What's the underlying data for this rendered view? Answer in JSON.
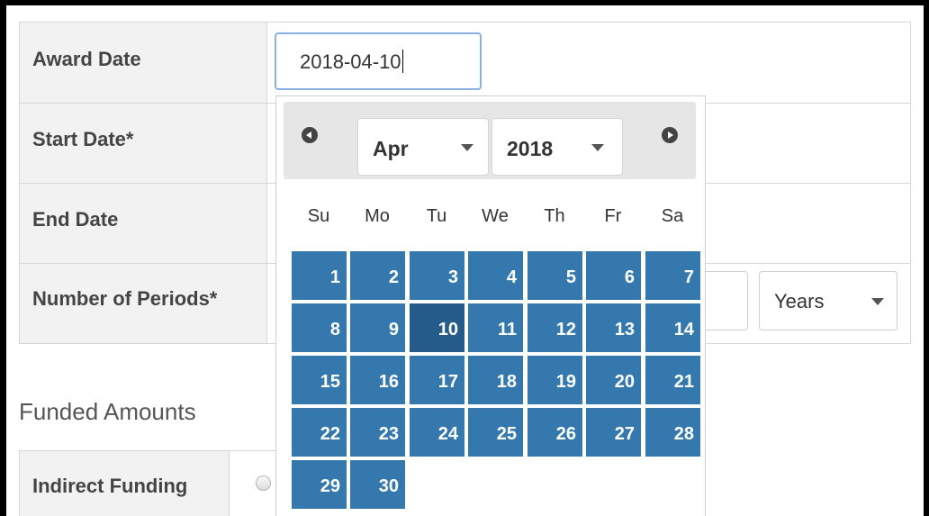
{
  "form": {
    "rows": [
      {
        "label": "Award Date"
      },
      {
        "label": "Start Date*"
      },
      {
        "label": "End Date"
      },
      {
        "label": "Number of Periods*"
      }
    ],
    "award_date_value": "2018-04-10",
    "period_unit": "Years"
  },
  "funded": {
    "section_title": "Funded Amounts",
    "indirect_label": "Indirect Funding"
  },
  "datepicker": {
    "month": "Apr",
    "year": "2018",
    "weekdays": [
      "Su",
      "Mo",
      "Tu",
      "We",
      "Th",
      "Fr",
      "Sa"
    ],
    "first_weekday_index": 0,
    "days_in_month": 30,
    "selected_day": 10,
    "colors": {
      "day": "#3478ad",
      "selected": "#245b8a",
      "header": "#e6e6e6"
    }
  }
}
